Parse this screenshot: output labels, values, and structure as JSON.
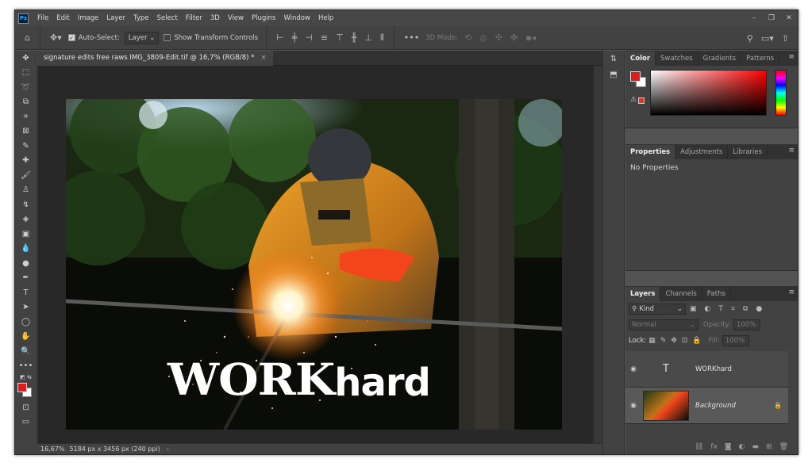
{
  "app": {
    "logo": "Ps"
  },
  "menu": [
    "File",
    "Edit",
    "Image",
    "Layer",
    "Type",
    "Select",
    "Filter",
    "3D",
    "View",
    "Plugins",
    "Window",
    "Help"
  ],
  "window_controls": [
    "–",
    "❐",
    "✕"
  ],
  "options": {
    "auto_select_label": "Auto-Select:",
    "auto_select_value": "Layer",
    "show_transform_label": "Show Transform Controls",
    "mode_3d_label": "3D Mode:"
  },
  "document": {
    "tab_title": "signature edits free raws IMG_3809-Edit.tif @ 16,7% (RGB/8) *",
    "close": "×",
    "overlay_big": "WORK",
    "overlay_small": "hard"
  },
  "status": {
    "zoom": "16,67%",
    "size": "5184 px x 3456 px (240 ppi)",
    "arrow": "›"
  },
  "color_panel": {
    "tabs": [
      "Color",
      "Swatches",
      "Gradients",
      "Patterns"
    ],
    "foreground": "#e11b1b",
    "background": "#ffffff"
  },
  "properties_panel": {
    "tabs": [
      "Properties",
      "Adjustments",
      "Libraries"
    ],
    "message": "No Properties"
  },
  "layers_panel": {
    "tabs": [
      "Layers",
      "Channels",
      "Paths"
    ],
    "kind_label": "Kind",
    "blend_mode": "Normal",
    "opacity_label": "Opacity:",
    "opacity_value": "100%",
    "lock_label": "Lock:",
    "fill_label": "Fill:",
    "fill_value": "100%",
    "layers": [
      {
        "name": "WORKhard",
        "type": "text",
        "thumb_glyph": "T"
      },
      {
        "name": "Background",
        "type": "image"
      }
    ]
  },
  "colors": {
    "app_bg": "#535353",
    "panel_bg": "#424242",
    "canvas_bg": "#282828"
  }
}
